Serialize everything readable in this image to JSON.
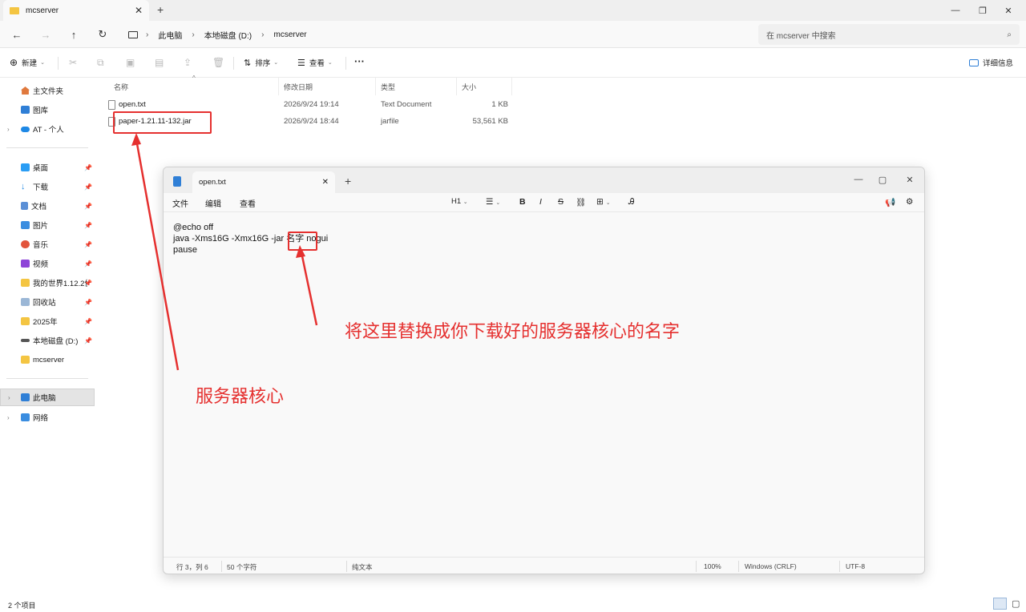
{
  "window": {
    "tab_title": "mcserver",
    "new_tab": "+",
    "minimize": "—",
    "maximize": "❐",
    "close": "✕"
  },
  "nav": {
    "back": "←",
    "forward": "→",
    "up": "↑",
    "refresh": "↻"
  },
  "breadcrumb": [
    "此电脑",
    "本地磁盘 (D:)",
    "mcserver"
  ],
  "search": {
    "placeholder": "在 mcserver 中搜索"
  },
  "toolbar": {
    "new_label": "新建",
    "sort_label": "排序",
    "view_label": "查看",
    "more": "···",
    "details_label": "详细信息"
  },
  "sidebar": {
    "items": [
      {
        "label": "主文件夹"
      },
      {
        "label": "图库"
      },
      {
        "label": "AT - 个人"
      },
      {
        "label": "桌面"
      },
      {
        "label": "下载"
      },
      {
        "label": "文档"
      },
      {
        "label": "图片"
      },
      {
        "label": "音乐"
      },
      {
        "label": "视频"
      },
      {
        "label": "我的世界1.12.2优"
      },
      {
        "label": "回收站"
      },
      {
        "label": "2025年"
      },
      {
        "label": "本地磁盘 (D:)"
      },
      {
        "label": "mcserver"
      },
      {
        "label": "此电脑"
      },
      {
        "label": "网络"
      }
    ]
  },
  "columns": {
    "name": "名称",
    "modified": "修改日期",
    "type": "类型",
    "size": "大小"
  },
  "files": [
    {
      "name": "open.txt",
      "modified": "2026/9/24 19:14",
      "type": "Text Document",
      "size": "1 KB"
    },
    {
      "name": "paper-1.21.11-132.jar",
      "modified": "2026/9/24 18:44",
      "type": "jarfile",
      "size": "53,561 KB"
    }
  ],
  "status": {
    "count": "2 个项目"
  },
  "notepad": {
    "tab_title": "open.txt",
    "menu": [
      "文件",
      "编辑",
      "查看"
    ],
    "format": {
      "heading": "H1",
      "bold": "B",
      "italic": "I",
      "strike": "S"
    },
    "lines": [
      "@echo off",
      "java -Xms16G -Xmx16G -jar 名字 nogui",
      "pause"
    ],
    "status": {
      "position": "行 3，列 6",
      "chars": "50 个字符",
      "mode": "纯文本",
      "zoom": "100%",
      "eol": "Windows (CRLF)",
      "encoding": "UTF-8"
    }
  },
  "annotations": {
    "replace_note": "将这里替换成你下载好的服务器核心的名字",
    "core_note": "服务器核心"
  },
  "colors": {
    "annotation": "#e5302f",
    "folder": "#f4c542",
    "accent": "#2f7fd6"
  }
}
